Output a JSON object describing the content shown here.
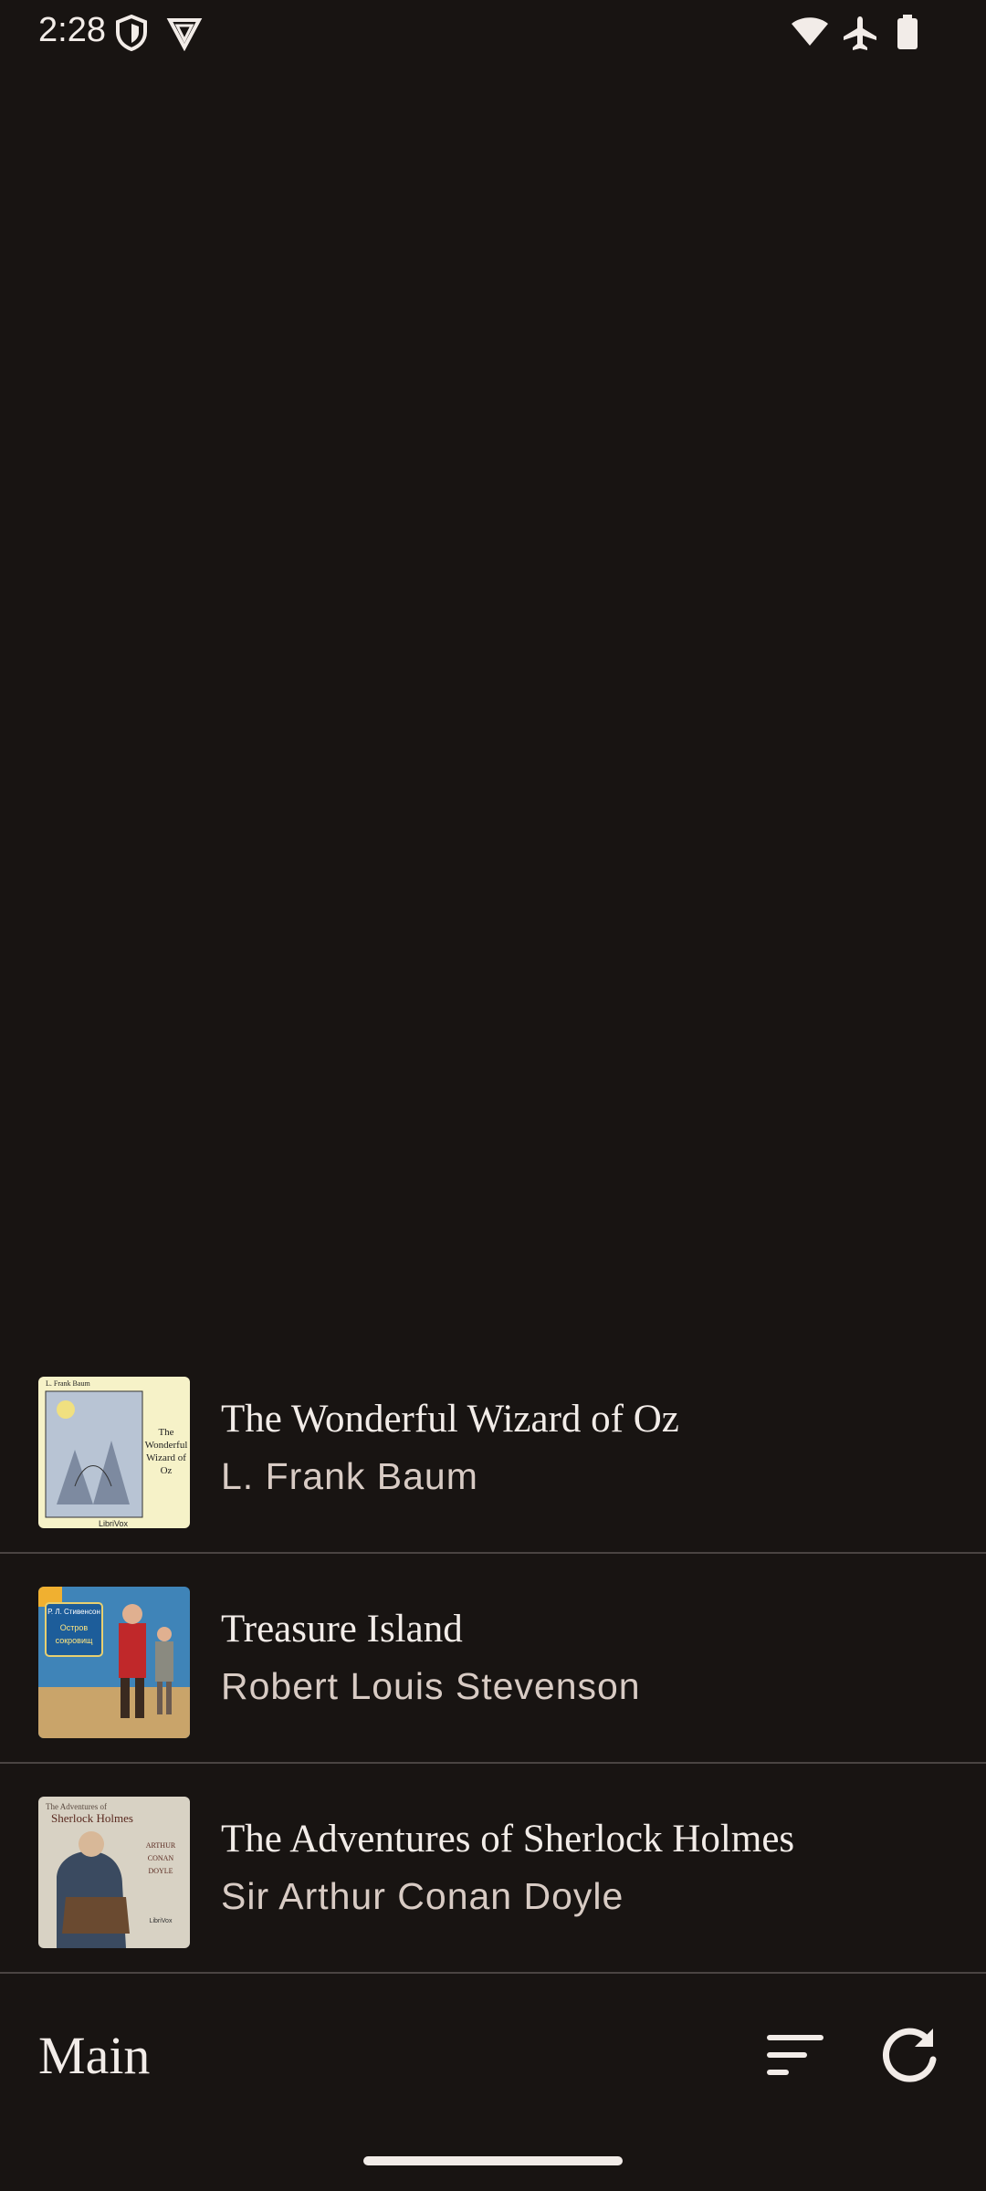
{
  "status": {
    "time": "2:28",
    "icons": [
      "shield-icon",
      "vpn-icon",
      "wifi-icon",
      "airplane-icon",
      "battery-icon"
    ]
  },
  "books": [
    {
      "title": "The Wonderful Wizard of Oz",
      "author": "L. Frank Baum",
      "cover": {
        "top_text": "L. Frank Baum",
        "title_text": "The Wonderful Wizard of Oz",
        "bottom_text": "LibriVox"
      }
    },
    {
      "title": "Treasure Island",
      "author": "Robert Louis Stevenson",
      "cover": {
        "top_text": "Р. Л. Стивенсон",
        "title_text": "Остров сокровищ"
      }
    },
    {
      "title": "The Adventures of Sherlock Holmes",
      "author": "Sir Arthur Conan Doyle",
      "cover": {
        "top_text": "The Adventures of Sherlock Holmes",
        "title_text": "ARTHUR CONAN DOYLE",
        "bottom_text": "LibriVox"
      }
    }
  ],
  "bottom_bar": {
    "title": "Main",
    "sort_icon": "sort-icon",
    "refresh_icon": "refresh-icon"
  },
  "colors": {
    "background": "#181412",
    "divider": "#4a4442",
    "text_primary": "#f2ece8",
    "text_secondary": "#d8cbc4"
  }
}
